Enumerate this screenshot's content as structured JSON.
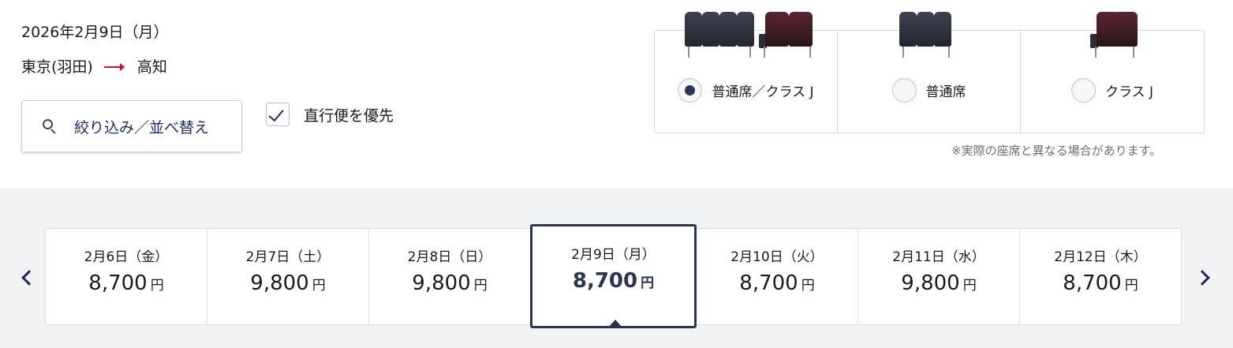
{
  "search": {
    "date": "2026年2月9日（月）",
    "origin": "東京(羽田)",
    "destination": "高知"
  },
  "filter": {
    "label": "絞り込み／並べ替え",
    "icon": "search-icon"
  },
  "direct_flight": {
    "label": "直行便を優先",
    "checked": true
  },
  "seat_class": {
    "options": [
      {
        "label": "普通席／クラス J",
        "selected": true
      },
      {
        "label": "普通席",
        "selected": false
      },
      {
        "label": "クラス J",
        "selected": false
      }
    ],
    "note": "※実際の座席と異なる場合があります。"
  },
  "date_strip": {
    "days": [
      {
        "date": "2月6日（金）",
        "price": "8,700",
        "unit": "円"
      },
      {
        "date": "2月7日（土）",
        "price": "9,800",
        "unit": "円"
      },
      {
        "date": "2月8日（日）",
        "price": "9,800",
        "unit": "円"
      },
      {
        "date": "2月9日（月）",
        "price": "8,700",
        "unit": "円",
        "selected": true
      },
      {
        "date": "2月10日（火）",
        "price": "8,700",
        "unit": "円"
      },
      {
        "date": "2月11日（水）",
        "price": "9,800",
        "unit": "円"
      },
      {
        "date": "2月12日（木）",
        "price": "8,700",
        "unit": "円"
      }
    ]
  },
  "colors": {
    "accent": "#2b3552",
    "route_arrow": "#c8102e",
    "strip_bg": "#f2f3f5"
  }
}
